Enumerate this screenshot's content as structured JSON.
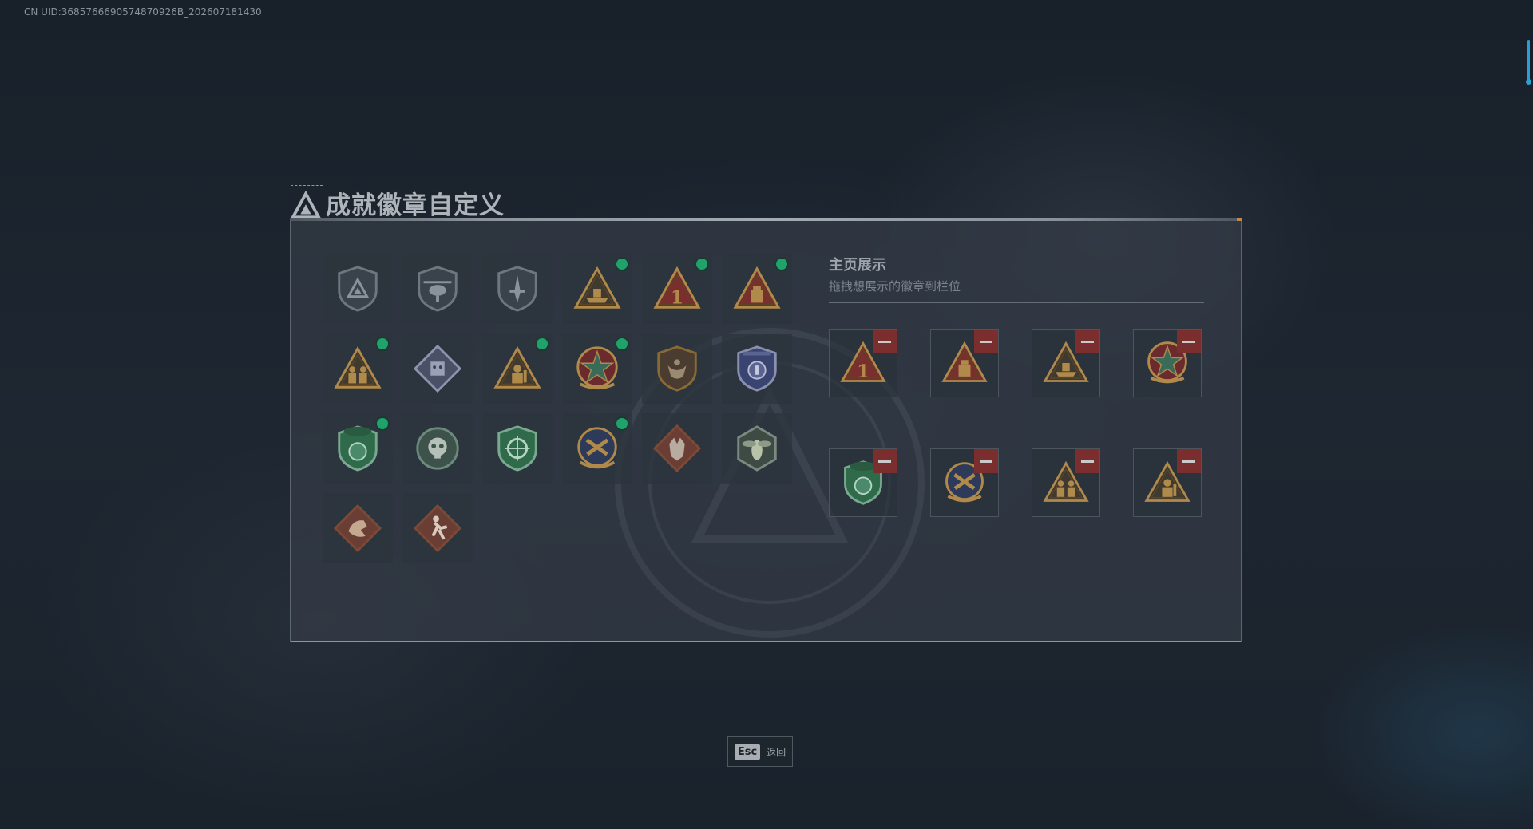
{
  "uid": "CN UID:3685766690574870926B_202607181430",
  "title": "成就徽章自定义",
  "showcase": {
    "title": "主页展示",
    "subtitle": "拖拽想展示的徽章到栏位"
  },
  "badges": [
    {
      "icon": "triangle-shield-badge-icon",
      "new": false
    },
    {
      "icon": "helicopter-badge-icon",
      "new": false
    },
    {
      "icon": "sword-shield-badge-icon",
      "new": false
    },
    {
      "icon": "ship-triangle-badge-icon",
      "new": true
    },
    {
      "icon": "number-one-triangle-badge-icon",
      "new": true
    },
    {
      "icon": "supply-box-triangle-badge-icon",
      "new": true
    },
    {
      "icon": "soldiers-triangle-badge-icon",
      "new": true
    },
    {
      "icon": "robot-diamond-badge-icon",
      "new": false
    },
    {
      "icon": "soldier-triangle-badge-icon",
      "new": true
    },
    {
      "icon": "star-medal-badge-icon",
      "new": true
    },
    {
      "icon": "wing-shield-badge-icon",
      "new": false
    },
    {
      "icon": "police-shield-badge-icon",
      "new": false
    },
    {
      "icon": "lion-beret-badge-icon",
      "new": true
    },
    {
      "icon": "skull-wreath-badge-icon",
      "new": false
    },
    {
      "icon": "crosshair-shield-badge-icon",
      "new": false
    },
    {
      "icon": "crossed-guns-medal-badge-icon",
      "new": true
    },
    {
      "icon": "wolf-diamond-badge-icon",
      "new": false
    },
    {
      "icon": "hornet-hexagon-badge-icon",
      "new": false
    },
    {
      "icon": "dragon-diamond-badge-icon",
      "new": false
    },
    {
      "icon": "runner-diamond-badge-icon",
      "new": false
    }
  ],
  "displayed": [
    {
      "icon": "number-one-triangle-badge-icon"
    },
    {
      "icon": "supply-box-triangle-badge-icon"
    },
    {
      "icon": "ship-triangle-badge-icon"
    },
    {
      "icon": "star-medal-badge-icon"
    },
    {
      "icon": "lion-beret-badge-icon"
    },
    {
      "icon": "crossed-guns-medal-badge-icon"
    },
    {
      "icon": "soldiers-triangle-badge-icon"
    },
    {
      "icon": "soldier-triangle-badge-icon"
    }
  ],
  "footer": {
    "esc_key": "Esc",
    "back_label": "返回"
  },
  "colors": {
    "gold": "#b08a4a",
    "bronze": "#8a6a34",
    "red": "#7a2e2e",
    "green": "#2f6b4a",
    "steel": "#6e7680",
    "navy": "#3a4470",
    "new_dot": "#1fa36b"
  }
}
